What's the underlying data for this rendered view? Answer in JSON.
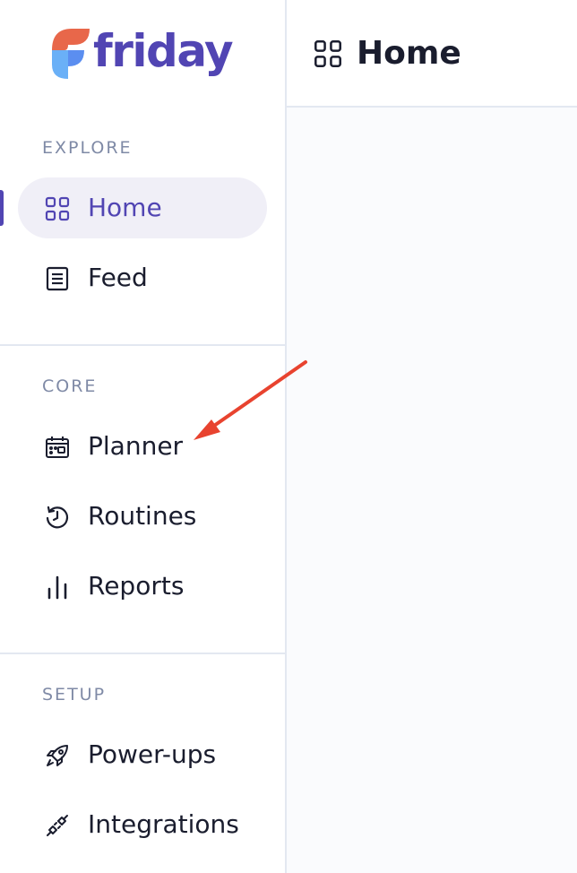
{
  "app": {
    "logo_text": "friday",
    "brand_color": "#5145b3",
    "logo_colors": [
      "#e8674a",
      "#5b8ef0",
      "#6ab0f7"
    ]
  },
  "sidebar": {
    "sections": [
      {
        "label": "EXPLORE",
        "items": [
          {
            "label": "Home",
            "icon": "grid-icon",
            "active": true
          },
          {
            "label": "Feed",
            "icon": "document-list-icon",
            "active": false
          }
        ]
      },
      {
        "label": "CORE",
        "items": [
          {
            "label": "Planner",
            "icon": "calendar-icon",
            "active": false
          },
          {
            "label": "Routines",
            "icon": "history-clock-icon",
            "active": false
          },
          {
            "label": "Reports",
            "icon": "bar-chart-icon",
            "active": false
          }
        ]
      },
      {
        "label": "SETUP",
        "items": [
          {
            "label": "Power-ups",
            "icon": "rocket-icon",
            "active": false
          },
          {
            "label": "Integrations",
            "icon": "plug-icon",
            "active": false
          }
        ]
      }
    ]
  },
  "header": {
    "title": "Home",
    "icon": "grid-icon"
  },
  "annotation": {
    "icon": "red-arrow-icon",
    "color": "#e8432f"
  }
}
